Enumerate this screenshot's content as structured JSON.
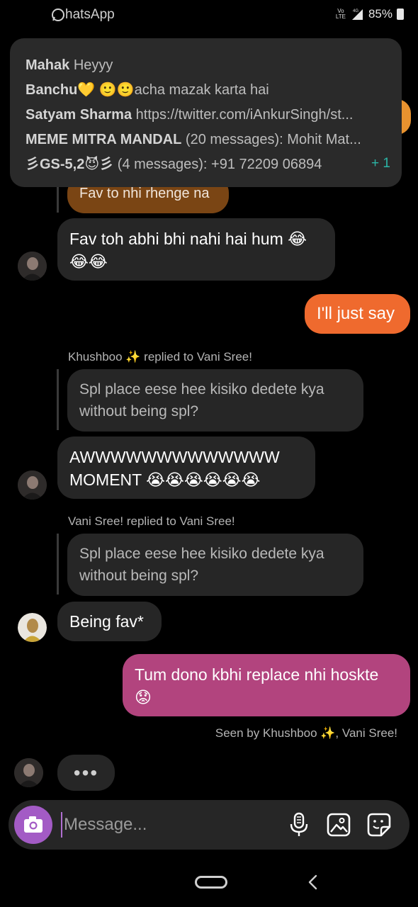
{
  "status_bar": {
    "app_name": "hatsApp",
    "net_top": "Vo",
    "net_bottom": "LTE",
    "net_type": "4G",
    "battery": "85%"
  },
  "notification": {
    "lines": [
      {
        "sender": "Mahak",
        "text": "Heyyy"
      },
      {
        "sender": "Banchu💛",
        "text": "🙂🙂acha mazak karta hai"
      },
      {
        "sender": "Satyam Sharma",
        "text": "https://twitter.com/iAnkurSingh/st..."
      },
      {
        "sender": "MEME MITRA MANDAL",
        "text": "(20 messages): Mohit Mat..."
      },
      {
        "sender": "彡GS-5,2😈彡",
        "text": "(4 messages): +91 72209 06894"
      }
    ],
    "more_count": "+ 1"
  },
  "messages": {
    "partial_reply": "Fav to nhi rhenge na",
    "m1_line1": "Fav toh abhi bhi nahi hai hum 😂",
    "m1_line2": "😂😂",
    "m2": "I'll just say",
    "reply1_label": "Khushboo ✨ replied to Vani Sree!",
    "reply1_quote_l1": "Spl place eese hee kisiko dedete kya",
    "reply1_quote_l2": "without being spl?",
    "m3_line1": "AWWWWWWWWWWWWW",
    "m3_line2": "MOMENT 😭😭😭😭😭😭",
    "reply2_label": "Vani Sree! replied to Vani Sree!",
    "reply2_quote_l1": "Spl place eese hee kisiko dedete kya",
    "reply2_quote_l2": "without being spl?",
    "m4": "Being fav*",
    "m5_line1": "Tum dono kbhi replace nhi hoskte",
    "m5_line2": "😟",
    "seen": "Seen by Khushboo ✨, Vani Sree!",
    "typing": "•••"
  },
  "composer": {
    "placeholder": "Message..."
  },
  "colors": {
    "orange_bubble": "#ef6a2e",
    "pink_bubble": "#b2447e",
    "brown_bubble": "#7a4514",
    "camera": "#a35bc5",
    "notif_count": "#2bb5a6"
  }
}
